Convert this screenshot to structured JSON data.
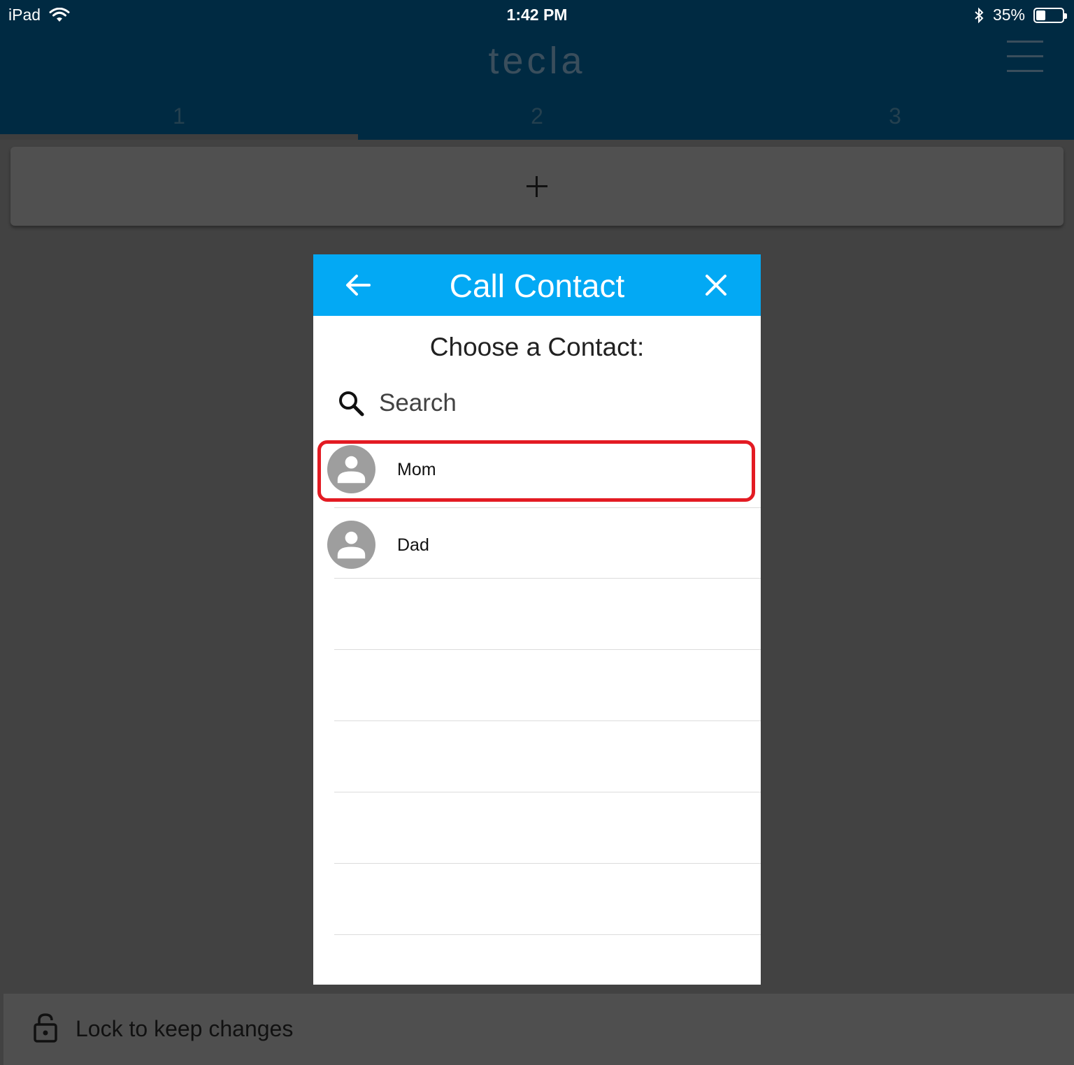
{
  "status_bar": {
    "device": "iPad",
    "time": "1:42 PM",
    "battery_percent_text": "35%",
    "battery_level": 0.35
  },
  "app": {
    "title": "tecla",
    "tabs": [
      {
        "label": "1",
        "active": true
      },
      {
        "label": "2",
        "active": false
      },
      {
        "label": "3",
        "active": false
      }
    ],
    "add_tile_icon": "plus-icon"
  },
  "dialog": {
    "title": "Call Contact",
    "subtitle": "Choose a Contact:",
    "search": {
      "placeholder": "Search",
      "value": ""
    },
    "contacts": [
      {
        "name": "Mom",
        "highlighted": true
      },
      {
        "name": "Dad",
        "highlighted": false
      }
    ],
    "header_color": "#03a9f4",
    "highlight_color": "#e31b23"
  },
  "footer": {
    "lock_label": "Lock to keep changes"
  }
}
